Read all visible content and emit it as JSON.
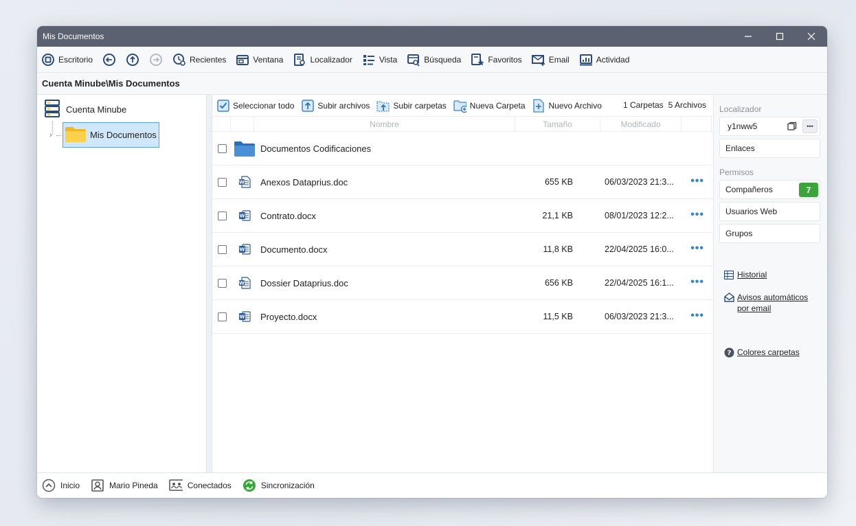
{
  "window": {
    "title": "Mis Documentos"
  },
  "toolbar": {
    "desktop": "Escritorio",
    "recent": "Recientes",
    "window": "Ventana",
    "locator": "Localizador",
    "view": "Vista",
    "search": "Búsqueda",
    "favorites": "Favoritos",
    "email": "Email",
    "activity": "Actividad"
  },
  "breadcrumb": "Cuenta Minube\\Mis Documentos",
  "tree": {
    "root": "Cuenta Minube",
    "node": "Mis Documentos"
  },
  "content_toolbar": {
    "select_all": "Seleccionar todo",
    "upload_files": "Subir archivos",
    "upload_folders": "Subir carpetas",
    "new_folder": "Nueva Carpeta",
    "new_file": "Nuevo Archivo",
    "folders_count": "1 Carpetas",
    "files_count": "5 Archivos"
  },
  "table": {
    "columns": {
      "name": "Nombre",
      "size": "Tamaño",
      "modified": "Modificado"
    },
    "folders": [
      {
        "name": "Documentos Codificaciones"
      }
    ],
    "files": [
      {
        "name": "Anexos Dataprius.doc",
        "size": "655 KB",
        "modified": "06/03/2023 21:3...",
        "type": "doc"
      },
      {
        "name": "Contrato.docx",
        "size": "21,1 KB",
        "modified": "08/01/2023 12:2...",
        "type": "docx"
      },
      {
        "name": "Documento.docx",
        "size": "11,8 KB",
        "modified": "22/04/2025 16:0...",
        "type": "docx"
      },
      {
        "name": "Dossier Dataprius.doc",
        "size": "656 KB",
        "modified": "22/04/2025 16:1...",
        "type": "doc"
      },
      {
        "name": "Proyecto.docx",
        "size": "11,5 KB",
        "modified": "06/03/2023 21:3...",
        "type": "docx"
      }
    ]
  },
  "sidebar": {
    "locator_label": "Localizador",
    "locator_value": "y1nww5",
    "links": "Enlaces",
    "permissions_label": "Permisos",
    "partners": "Compañeros",
    "partners_count": "7",
    "web_users": "Usuarios Web",
    "groups": "Grupos",
    "history": "Historial",
    "auto_notices_1": "Avisos automáticos",
    "auto_notices_2": "por email",
    "folder_colors": "Colores carpetas"
  },
  "statusbar": {
    "home": "Inicio",
    "user": "Mario Pineda",
    "connected": "Conectados",
    "sync": "Sincronización"
  },
  "colors": {
    "accent": "#2f86cf",
    "titlebar": "#5b6171",
    "badge": "#3ba53b",
    "icon_navy": "#2c4c7c",
    "folder": "#f5c12e"
  }
}
